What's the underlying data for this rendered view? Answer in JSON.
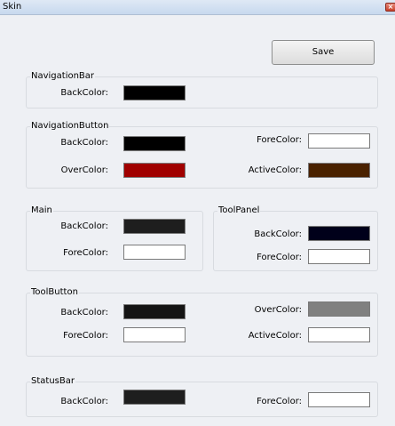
{
  "window": {
    "title": "Skin"
  },
  "toolbar": {
    "save_label": "Save"
  },
  "groups": {
    "navigation_bar": {
      "label": "NavigationBar",
      "back_color": {
        "label": "BackColor:",
        "value": "#000000"
      }
    },
    "navigation_button": {
      "label": "NavigationButton",
      "back_color": {
        "label": "BackColor:",
        "value": "#000000"
      },
      "fore_color": {
        "label": "ForeColor:",
        "value": "#FFFFFF"
      },
      "over_color": {
        "label": "OverColor:",
        "value": "#A00000"
      },
      "active_color": {
        "label": "ActiveColor:",
        "value": "#4A2200"
      }
    },
    "main": {
      "label": "Main",
      "back_color": {
        "label": "BackColor:",
        "value": "#1E1E1E"
      },
      "fore_color": {
        "label": "ForeColor:",
        "value": "#FFFFFF"
      }
    },
    "tool_panel": {
      "label": "ToolPanel",
      "back_color": {
        "label": "BackColor:",
        "value": "#00001A"
      },
      "fore_color": {
        "label": "ForeColor:",
        "value": "#FFFFFF"
      }
    },
    "tool_button": {
      "label": "ToolButton",
      "back_color": {
        "label": "BackColor:",
        "value": "#141414"
      },
      "fore_color": {
        "label": "ForeColor:",
        "value": "#FFFFFF"
      },
      "over_color": {
        "label": "OverColor:",
        "value": "#808080"
      },
      "active_color": {
        "label": "ActiveColor:",
        "value": "#FFFFFF"
      }
    },
    "status_bar": {
      "label": "StatusBar",
      "back_color": {
        "label": "BackColor:",
        "value": "#1E1E1E"
      },
      "fore_color": {
        "label": "ForeColor:",
        "value": "#FFFFFF"
      }
    }
  },
  "icons": {
    "close": "close-icon"
  }
}
